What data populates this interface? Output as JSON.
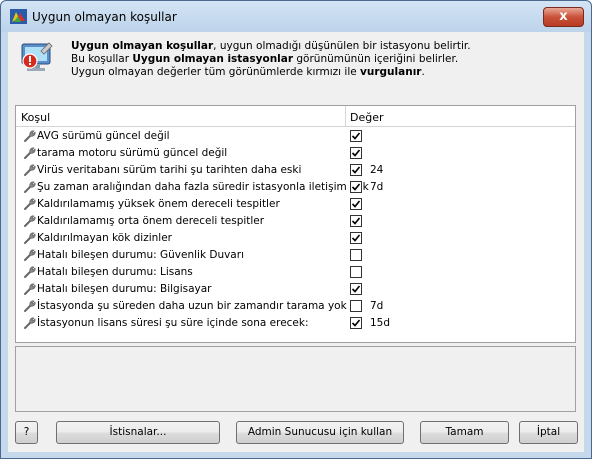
{
  "window": {
    "title": "Uygun olmayan koşullar",
    "close_glyph": "x",
    "app_icon": "avg-logo-icon",
    "header_icon": "computer-warning-icon"
  },
  "description": {
    "line1_bold": "Uygun olmayan koşullar",
    "line1_rest": ", uygun olmadığı düşünülen bir istasyonu belirtir.",
    "line2_pre": "Bu koşullar ",
    "line2_bold": "Uygun olmayan istasyonlar",
    "line2_rest": " görünümünün içeriğini belirler.",
    "line3_pre": "Uygun olmayan değerler tüm görünümlerde kırmızı ile ",
    "line3_bold": "vurgulanır",
    "line3_rest": "."
  },
  "grid": {
    "col_condition": "Koşul",
    "col_value": "Değer",
    "rows": [
      {
        "label": "AVG sürümü güncel değil",
        "checked": true,
        "value": ""
      },
      {
        "label": "tarama motoru sürümü güncel değil",
        "checked": true,
        "value": ""
      },
      {
        "label": "Virüs veritabanı sürüm tarihi şu tarihten daha eski",
        "checked": true,
        "value": "24"
      },
      {
        "label": "Şu zaman aralığından daha fazla süredir istasyonla iletişim yok",
        "checked": true,
        "value": "7d"
      },
      {
        "label": "Kaldırılamamış yüksek önem dereceli tespitler",
        "checked": true,
        "value": ""
      },
      {
        "label": "Kaldırılamamış orta önem dereceli tespitler",
        "checked": true,
        "value": ""
      },
      {
        "label": "Kaldırılmayan kök dizinler",
        "checked": true,
        "value": ""
      },
      {
        "label": "Hatalı bileşen durumu: Güvenlik Duvarı",
        "checked": false,
        "value": ""
      },
      {
        "label": "Hatalı bileşen durumu: Lisans",
        "checked": false,
        "value": ""
      },
      {
        "label": "Hatalı bileşen durumu: Bilgisayar",
        "checked": true,
        "value": ""
      },
      {
        "label": "İstasyonda şu süreden daha uzun bir zamandır tarama yok",
        "checked": false,
        "value": "7d"
      },
      {
        "label": "İstasyonun lisans süresi şu süre içinde sona erecek:",
        "checked": true,
        "value": "15d"
      }
    ]
  },
  "buttons": {
    "help": "?",
    "exceptions": "İstisnalar...",
    "use_admin_server": "Admin Sunucusu için kullan",
    "ok": "Tamam",
    "cancel": "İptal"
  }
}
